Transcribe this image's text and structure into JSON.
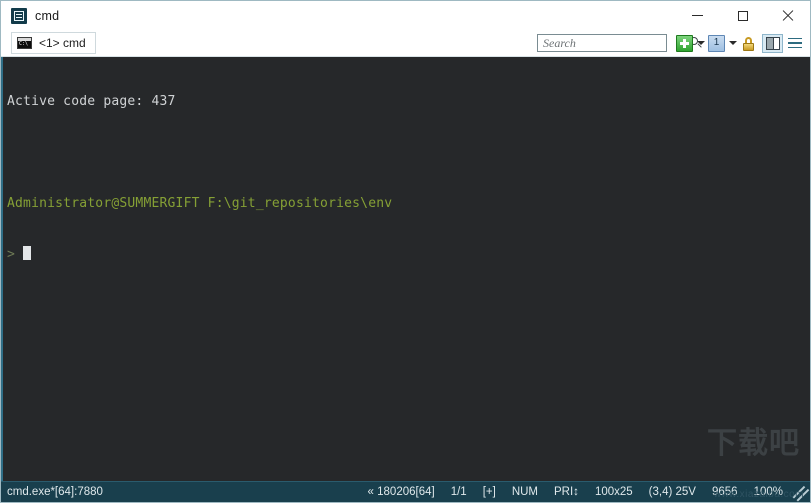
{
  "window": {
    "title": "cmd",
    "app_icon": "conemu-icon",
    "controls": {
      "minimize": "minimize-icon",
      "maximize": "maximize-icon",
      "close": "close-icon"
    }
  },
  "tabs": [
    {
      "label": "<1> cmd",
      "icon": "console-window-icon",
      "active": true
    }
  ],
  "toolbar": {
    "search": {
      "placeholder": "Search",
      "value": "",
      "icon": "magnifier-icon"
    },
    "new_console": {
      "icon": "green-plus-icon",
      "label": "+"
    },
    "new_console_caret": {
      "icon": "chevron-down-icon"
    },
    "active_console": {
      "icon": "console-number-icon",
      "label": "1"
    },
    "active_console_caret": {
      "icon": "chevron-down-icon"
    },
    "lock": {
      "icon": "padlock-icon"
    },
    "panes": {
      "icon": "split-panes-icon"
    },
    "menu": {
      "icon": "hamburger-menu-icon"
    }
  },
  "console": {
    "lines": [
      {
        "text": "Active code page: 437",
        "style": "out"
      },
      {
        "text": "",
        "style": "blank"
      },
      {
        "text": "Administrator@SUMMERGIFT F:\\git_repositories\\env",
        "style": "prompt"
      },
      {
        "text": ">",
        "style": "input",
        "cursor": true
      }
    ],
    "colors": {
      "background": "#26282a",
      "output": "#cfd2d4",
      "prompt": "#85a035",
      "input": "#6e7a55",
      "cursor": "#e3e6e8",
      "left_border": "#2f6e86"
    },
    "watermark": {
      "text": "下载吧",
      "url": "www.xiazaiba.com"
    }
  },
  "statusbar": {
    "process": "cmd.exe*[64]:7880",
    "items": [
      "« 180206[64]",
      "1/1",
      "[+]",
      "NUM",
      "PRI↕",
      "100x25",
      "(3,4) 25V",
      "9656",
      "100%"
    ],
    "colors": {
      "background": "#193f4d",
      "text": "#dfe8eb"
    }
  }
}
